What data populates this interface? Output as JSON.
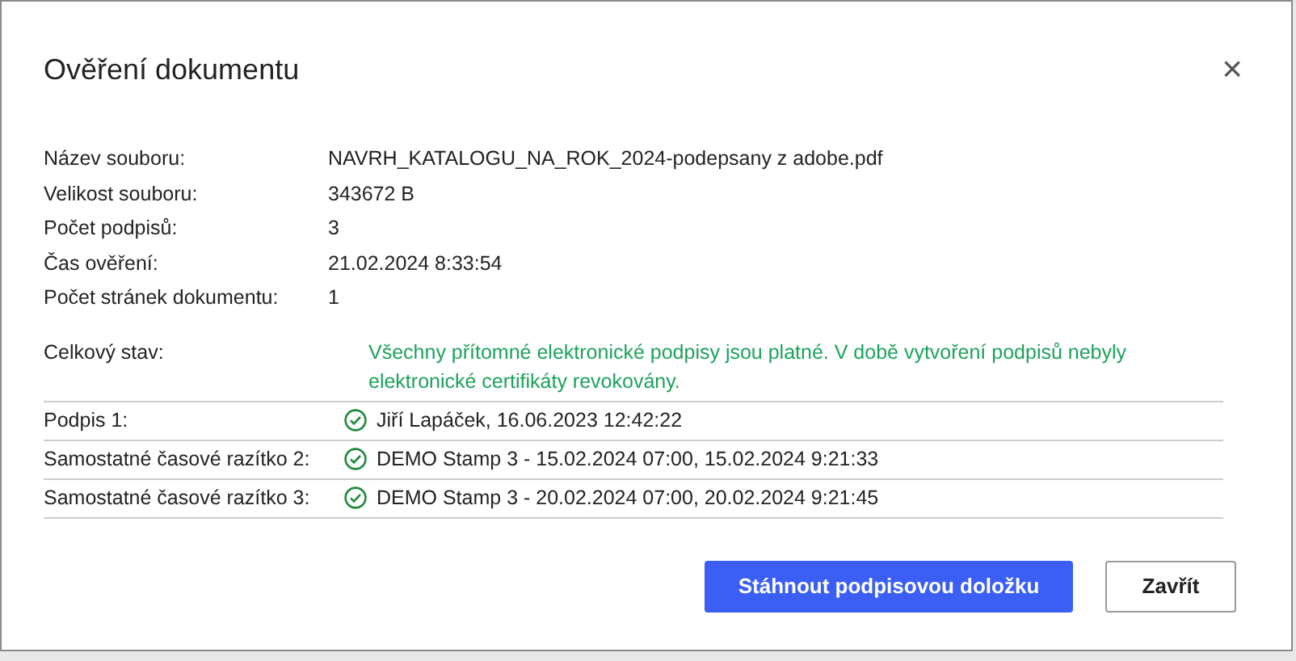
{
  "dialog": {
    "title": "Ověření dokumentu",
    "close": "×"
  },
  "info": [
    {
      "label": "Název souboru:",
      "value": "NAVRH_KATALOGU_NA_ROK_2024-podepsany z adobe.pdf"
    },
    {
      "label": "Velikost souboru:",
      "value": "343672 B"
    },
    {
      "label": "Počet podpisů:",
      "value": "3"
    },
    {
      "label": "Čas ověření:",
      "value": "21.02.2024 8:33:54"
    },
    {
      "label": "Počet stránek dokumentu:",
      "value": "1"
    }
  ],
  "status": {
    "label": "Celkový stav:",
    "message": "Všechny přítomné elektronické podpisy jsou platné. V době vytvoření podpisů nebyly elektronické certifikáty revokovány."
  },
  "signatures": [
    {
      "label": "Podpis 1:",
      "valid": true,
      "detail": "Jiří Lapáček, 16.06.2023 12:42:22"
    },
    {
      "label": "Samostatné časové razítko 2:",
      "valid": true,
      "detail": "DEMO Stamp 3 - 15.02.2024 07:00, 15.02.2024 9:21:33"
    },
    {
      "label": "Samostatné časové razítko 3:",
      "valid": true,
      "detail": "DEMO Stamp 3 - 20.02.2024 07:00, 20.02.2024 9:21:45"
    }
  ],
  "buttons": [
    {
      "label": "Stáhnout podpisovou doložku",
      "kind": "primary"
    },
    {
      "label": "Zavřít",
      "kind": "secondary"
    }
  ]
}
